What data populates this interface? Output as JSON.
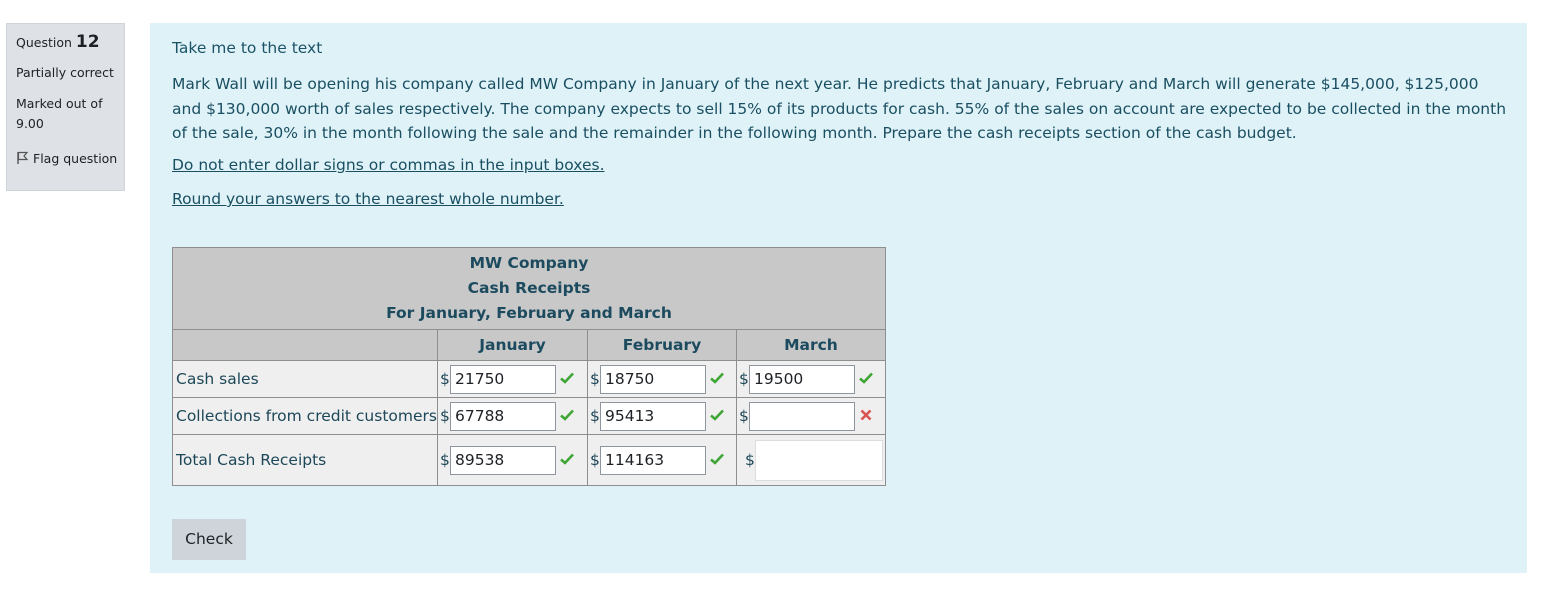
{
  "info": {
    "question_label": "Question",
    "question_number": "12",
    "state": "Partially correct",
    "marked_out_of": "Marked out of 9.00",
    "flag_label": "Flag question"
  },
  "content": {
    "take_me_link": "Take me to the text",
    "question_text": "Mark Wall will be opening his company called MW Company in January of the next year. He predicts that January, February and March will generate $145,000, $125,000 and $130,000 worth of sales respectively. The company expects to sell 15% of its products for cash. 55% of the sales on account are expected to be collected in the month of the sale, 30% in the month following the sale and the remainder in the following month. Prepare the cash receipts section of the cash budget.",
    "instruction_1": "Do not enter dollar signs or commas in the input boxes.",
    "instruction_2": "Round your answers to the nearest whole number."
  },
  "table": {
    "title_1": "MW Company",
    "title_2": "Cash Receipts",
    "title_3": "For January, February and March",
    "columns": [
      "January",
      "February",
      "March"
    ],
    "currency_symbol": "$",
    "rows": [
      {
        "label": "Cash sales",
        "values": [
          "21750",
          "18750",
          "19500"
        ],
        "status": [
          "correct",
          "correct",
          "correct"
        ]
      },
      {
        "label": "Collections from credit customers",
        "values": [
          "67788",
          "95413",
          ""
        ],
        "status": [
          "correct",
          "correct",
          "incorrect"
        ]
      },
      {
        "label": "Total Cash Receipts",
        "values": [
          "89538",
          "114163",
          ""
        ],
        "status": [
          "correct",
          "correct",
          "none"
        ]
      }
    ]
  },
  "check_button": "Check",
  "colors": {
    "correct": "#3fa535",
    "incorrect": "#d9534f",
    "content_bg": "#def2f8",
    "info_bg": "#dee2e6"
  }
}
